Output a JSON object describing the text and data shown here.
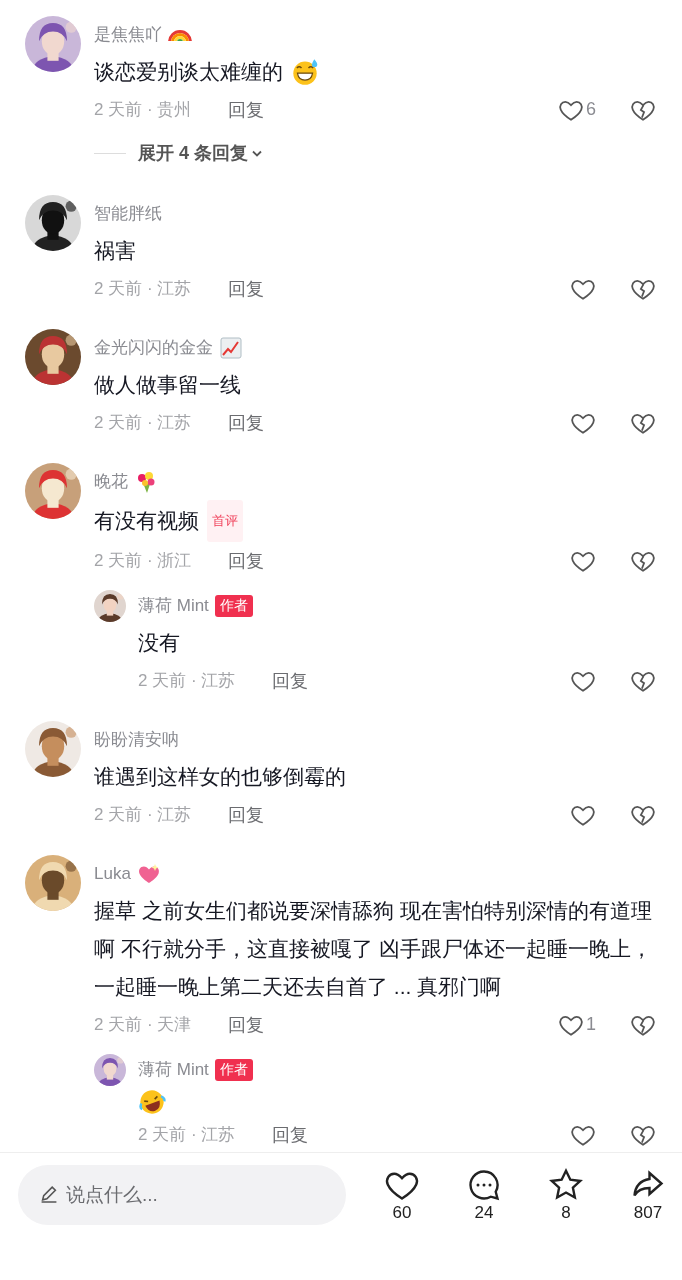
{
  "comments": [
    {
      "name": "是焦焦吖",
      "name_icon": {
        "kind": "rainbow"
      },
      "text": "谈恋爱别谈太难缠的",
      "text_icon": {
        "kind": "grin-sweat"
      },
      "time": "2 天前 · 贵州",
      "reply": "回复",
      "likes": "6",
      "expand": "展开 4 条回复"
    },
    {
      "name": "智能胖纸",
      "text": "祸害",
      "time": "2 天前 · 江苏",
      "reply": "回复"
    },
    {
      "name": "金光闪闪的金金",
      "name_icon": {
        "kind": "chart"
      },
      "text": "做人做事留一线",
      "time": "2 天前 · 江苏",
      "reply": "回复"
    },
    {
      "name": "晚花",
      "name_icon": {
        "kind": "bouquet"
      },
      "text": "有没有视频",
      "tag": {
        "kind": "first",
        "label": "首评"
      },
      "time": "2 天前 · 浙江",
      "reply": "回复",
      "replies": [
        {
          "name": "薄荷 Mint",
          "tag": {
            "kind": "author",
            "label": "作者"
          },
          "text": "没有",
          "time": "2 天前 · 江苏",
          "reply": "回复"
        }
      ]
    },
    {
      "name": "盼盼清安呐",
      "text": "谁遇到这样女的也够倒霉的",
      "time": "2 天前 · 江苏",
      "reply": "回复"
    },
    {
      "name": "Luka",
      "name_icon": {
        "kind": "sparkle-heart"
      },
      "text": "握草 之前女生们都说要深情舔狗 现在害怕特别深情的有道理啊  不行就分手，这直接被嘎了 凶手跟尸体还一起睡一晚上，一起睡一晚上第二天还去自首了 ... 真邪门啊",
      "time": "2 天前 · 天津",
      "reply": "回复",
      "likes": "1",
      "replies": [
        {
          "name": "薄荷 Mint",
          "tag": {
            "kind": "author",
            "label": "作者"
          },
          "text_icon": {
            "kind": "laugh"
          },
          "time": "2 天前 · 江苏",
          "reply": "回复"
        }
      ]
    }
  ],
  "composer": {
    "placeholder": "说点什么..."
  },
  "actions": [
    {
      "kind": "like",
      "count": "60"
    },
    {
      "kind": "comment",
      "count": "24"
    },
    {
      "kind": "favorite",
      "count": "8"
    },
    {
      "kind": "share",
      "count": "807"
    }
  ]
}
